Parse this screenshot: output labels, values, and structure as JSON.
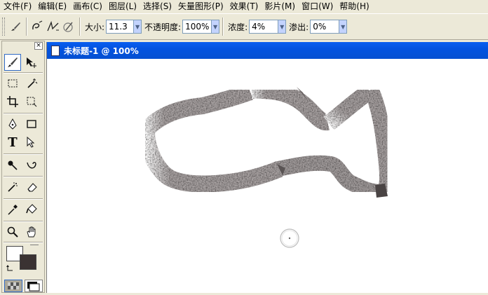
{
  "menubar": {
    "items": [
      {
        "label": "文件(F)",
        "name": "menu-file"
      },
      {
        "label": "编辑(E)",
        "name": "menu-edit"
      },
      {
        "label": "画布(C)",
        "name": "menu-canvas"
      },
      {
        "label": "图层(L)",
        "name": "menu-layer"
      },
      {
        "label": "选择(S)",
        "name": "menu-select"
      },
      {
        "label": "矢量图形(P)",
        "name": "menu-vector"
      },
      {
        "label": "效果(T)",
        "name": "menu-effects"
      },
      {
        "label": "影片(M)",
        "name": "menu-movie"
      },
      {
        "label": "窗口(W)",
        "name": "menu-window"
      },
      {
        "label": "帮助(H)",
        "name": "menu-help"
      }
    ]
  },
  "options": {
    "size_label": "大小:",
    "size_value": "11.3",
    "opacity_label": "不透明度:",
    "opacity_value": "100%",
    "density_label": "浓度:",
    "density_value": "4%",
    "bleed_label": "渗出:",
    "bleed_value": "0%"
  },
  "document": {
    "title": "未标题-1 @ 100%"
  },
  "toolbox": {
    "close_glyph": "×",
    "text_tool_glyph": "T"
  },
  "colors": {
    "foreground": "#ffffff",
    "background": "#3a3232",
    "doc_titlebar": "#0453e0"
  }
}
